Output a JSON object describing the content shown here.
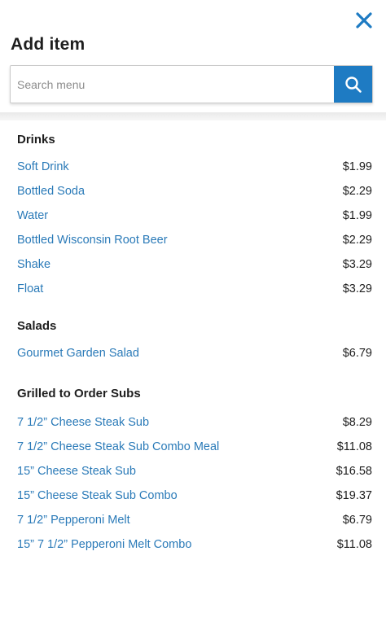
{
  "header": {
    "title": "Add item"
  },
  "search": {
    "placeholder": "Search menu",
    "value": ""
  },
  "icons": {
    "close": "close-icon",
    "search": "search-icon"
  },
  "colors": {
    "accent": "#1e7bc3",
    "link": "#2a7ab8",
    "text": "#1e1e1e"
  },
  "sections": [
    {
      "title": "Drinks",
      "items": [
        {
          "name": "Soft Drink",
          "price": "$1.99"
        },
        {
          "name": "Bottled Soda",
          "price": "$2.29"
        },
        {
          "name": "Water",
          "price": "$1.99"
        },
        {
          "name": "Bottled Wisconsin Root Beer",
          "price": "$2.29"
        },
        {
          "name": "Shake",
          "price": "$3.29"
        },
        {
          "name": "Float",
          "price": "$3.29"
        }
      ]
    },
    {
      "title": "Salads",
      "items": [
        {
          "name": "Gourmet Garden Salad",
          "price": "$6.79"
        }
      ]
    },
    {
      "title": "Grilled to Order Subs",
      "items": [
        {
          "name": "7 1/2” Cheese Steak Sub",
          "price": "$8.29"
        },
        {
          "name": "7 1/2” Cheese Steak Sub Combo Meal",
          "price": "$11.08"
        },
        {
          "name": "15” Cheese Steak Sub",
          "price": "$16.58"
        },
        {
          "name": "15” Cheese Steak Sub Combo",
          "price": "$19.37"
        },
        {
          "name": "7 1/2” Pepperoni Melt",
          "price": "$6.79"
        },
        {
          "name": "15” 7 1/2” Pepperoni Melt Combo",
          "price": "$11.08"
        }
      ]
    }
  ]
}
